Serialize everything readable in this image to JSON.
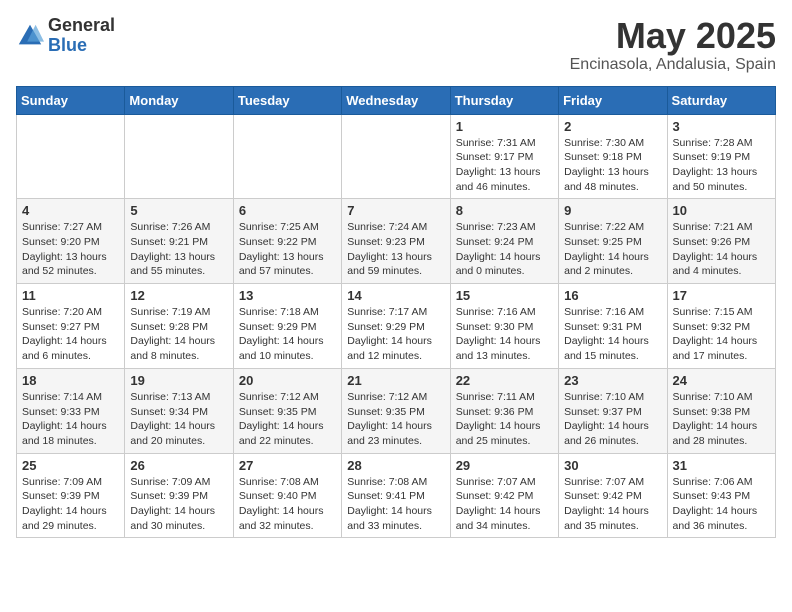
{
  "logo": {
    "general": "General",
    "blue": "Blue"
  },
  "title": {
    "month_year": "May 2025",
    "location": "Encinasola, Andalusia, Spain"
  },
  "days_of_week": [
    "Sunday",
    "Monday",
    "Tuesday",
    "Wednesday",
    "Thursday",
    "Friday",
    "Saturday"
  ],
  "weeks": [
    [
      {
        "day": "",
        "info": ""
      },
      {
        "day": "",
        "info": ""
      },
      {
        "day": "",
        "info": ""
      },
      {
        "day": "",
        "info": ""
      },
      {
        "day": "1",
        "info": "Sunrise: 7:31 AM\nSunset: 9:17 PM\nDaylight: 13 hours\nand 46 minutes."
      },
      {
        "day": "2",
        "info": "Sunrise: 7:30 AM\nSunset: 9:18 PM\nDaylight: 13 hours\nand 48 minutes."
      },
      {
        "day": "3",
        "info": "Sunrise: 7:28 AM\nSunset: 9:19 PM\nDaylight: 13 hours\nand 50 minutes."
      }
    ],
    [
      {
        "day": "4",
        "info": "Sunrise: 7:27 AM\nSunset: 9:20 PM\nDaylight: 13 hours\nand 52 minutes."
      },
      {
        "day": "5",
        "info": "Sunrise: 7:26 AM\nSunset: 9:21 PM\nDaylight: 13 hours\nand 55 minutes."
      },
      {
        "day": "6",
        "info": "Sunrise: 7:25 AM\nSunset: 9:22 PM\nDaylight: 13 hours\nand 57 minutes."
      },
      {
        "day": "7",
        "info": "Sunrise: 7:24 AM\nSunset: 9:23 PM\nDaylight: 13 hours\nand 59 minutes."
      },
      {
        "day": "8",
        "info": "Sunrise: 7:23 AM\nSunset: 9:24 PM\nDaylight: 14 hours\nand 0 minutes."
      },
      {
        "day": "9",
        "info": "Sunrise: 7:22 AM\nSunset: 9:25 PM\nDaylight: 14 hours\nand 2 minutes."
      },
      {
        "day": "10",
        "info": "Sunrise: 7:21 AM\nSunset: 9:26 PM\nDaylight: 14 hours\nand 4 minutes."
      }
    ],
    [
      {
        "day": "11",
        "info": "Sunrise: 7:20 AM\nSunset: 9:27 PM\nDaylight: 14 hours\nand 6 minutes."
      },
      {
        "day": "12",
        "info": "Sunrise: 7:19 AM\nSunset: 9:28 PM\nDaylight: 14 hours\nand 8 minutes."
      },
      {
        "day": "13",
        "info": "Sunrise: 7:18 AM\nSunset: 9:29 PM\nDaylight: 14 hours\nand 10 minutes."
      },
      {
        "day": "14",
        "info": "Sunrise: 7:17 AM\nSunset: 9:29 PM\nDaylight: 14 hours\nand 12 minutes."
      },
      {
        "day": "15",
        "info": "Sunrise: 7:16 AM\nSunset: 9:30 PM\nDaylight: 14 hours\nand 13 minutes."
      },
      {
        "day": "16",
        "info": "Sunrise: 7:16 AM\nSunset: 9:31 PM\nDaylight: 14 hours\nand 15 minutes."
      },
      {
        "day": "17",
        "info": "Sunrise: 7:15 AM\nSunset: 9:32 PM\nDaylight: 14 hours\nand 17 minutes."
      }
    ],
    [
      {
        "day": "18",
        "info": "Sunrise: 7:14 AM\nSunset: 9:33 PM\nDaylight: 14 hours\nand 18 minutes."
      },
      {
        "day": "19",
        "info": "Sunrise: 7:13 AM\nSunset: 9:34 PM\nDaylight: 14 hours\nand 20 minutes."
      },
      {
        "day": "20",
        "info": "Sunrise: 7:12 AM\nSunset: 9:35 PM\nDaylight: 14 hours\nand 22 minutes."
      },
      {
        "day": "21",
        "info": "Sunrise: 7:12 AM\nSunset: 9:35 PM\nDaylight: 14 hours\nand 23 minutes."
      },
      {
        "day": "22",
        "info": "Sunrise: 7:11 AM\nSunset: 9:36 PM\nDaylight: 14 hours\nand 25 minutes."
      },
      {
        "day": "23",
        "info": "Sunrise: 7:10 AM\nSunset: 9:37 PM\nDaylight: 14 hours\nand 26 minutes."
      },
      {
        "day": "24",
        "info": "Sunrise: 7:10 AM\nSunset: 9:38 PM\nDaylight: 14 hours\nand 28 minutes."
      }
    ],
    [
      {
        "day": "25",
        "info": "Sunrise: 7:09 AM\nSunset: 9:39 PM\nDaylight: 14 hours\nand 29 minutes."
      },
      {
        "day": "26",
        "info": "Sunrise: 7:09 AM\nSunset: 9:39 PM\nDaylight: 14 hours\nand 30 minutes."
      },
      {
        "day": "27",
        "info": "Sunrise: 7:08 AM\nSunset: 9:40 PM\nDaylight: 14 hours\nand 32 minutes."
      },
      {
        "day": "28",
        "info": "Sunrise: 7:08 AM\nSunset: 9:41 PM\nDaylight: 14 hours\nand 33 minutes."
      },
      {
        "day": "29",
        "info": "Sunrise: 7:07 AM\nSunset: 9:42 PM\nDaylight: 14 hours\nand 34 minutes."
      },
      {
        "day": "30",
        "info": "Sunrise: 7:07 AM\nSunset: 9:42 PM\nDaylight: 14 hours\nand 35 minutes."
      },
      {
        "day": "31",
        "info": "Sunrise: 7:06 AM\nSunset: 9:43 PM\nDaylight: 14 hours\nand 36 minutes."
      }
    ]
  ]
}
